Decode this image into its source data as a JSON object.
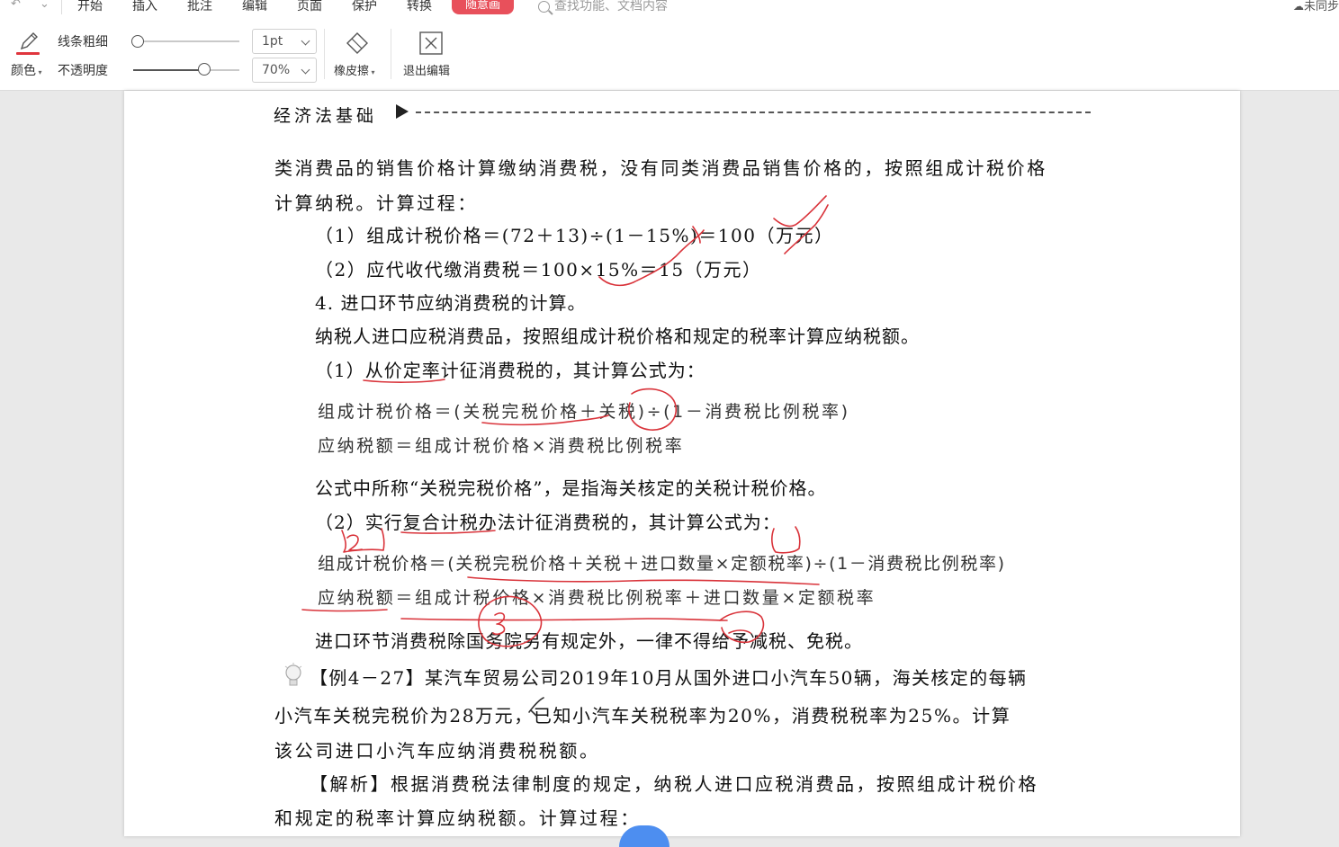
{
  "menu": {
    "quick_access": "↶",
    "quick_access_2": "⌄",
    "items": [
      "开始",
      "插入",
      "批注",
      "编辑",
      "页面",
      "保护",
      "转换"
    ],
    "active_tab": "随意画",
    "search_placeholder": "查找功能、文档内容",
    "sync_status": "未同步"
  },
  "toolbar": {
    "color_label": "颜色",
    "line_width_label": "线条粗细",
    "opacity_label": "不透明度",
    "line_width_value": "1pt",
    "opacity_value": "70%",
    "eraser_label": "橡皮擦",
    "exit_label": "退出编辑",
    "accent_color": "#e0353d"
  },
  "document": {
    "header_title": "经济法基础",
    "lines": [
      "类消费品的销售价格计算缴纳消费税，没有同类消费品销售价格的，按照组成计税价格",
      "计算纳税。计算过程：",
      "（1）组成计税价格＝(72＋13)÷(1－15%)＝100（万元）",
      "（2）应代收代缴消费税＝100×15%＝15（万元）",
      "4. 进口环节应纳消费税的计算。",
      "纳税人进口应税消费品，按照组成计税价格和规定的税率计算应纳税额。",
      "（1）从价定率计征消费税的，其计算公式为：",
      "组成计税价格＝(关税完税价格＋关税)÷(1－消费税比例税率)",
      "应纳税额＝组成计税价格×消费税比例税率",
      "公式中所称“关税完税价格”，是指海关核定的关税计税价格。",
      "（2）实行复合计税办法计征消费税的，其计算公式为：",
      "组成计税价格＝(关税完税价格＋关税＋进口数量×定额税率)÷(1－消费税比例税率)",
      "应纳税额＝组成计税价格×消费税比例税率＋进口数量×定额税率",
      "进口环节消费税除国务院另有规定外，一律不得给予减税、免税。",
      "【例4－27】某汽车贸易公司2019年10月从国外进口小汽车50辆，海关核定的每辆",
      "小汽车关税完税价为28万元，已知小汽车关税税率为20%，消费税税率为25%。计算",
      "该公司进口小汽车应纳消费税税额。",
      "【解析】根据消费税法律制度的规定，纳税人进口应税消费品，按照组成计税价格",
      "和规定的税率计算应纳税额。计算过程："
    ]
  },
  "annotations": {
    "ink_color": "#d9333a",
    "handwritten_marks": [
      "2"
    ]
  }
}
